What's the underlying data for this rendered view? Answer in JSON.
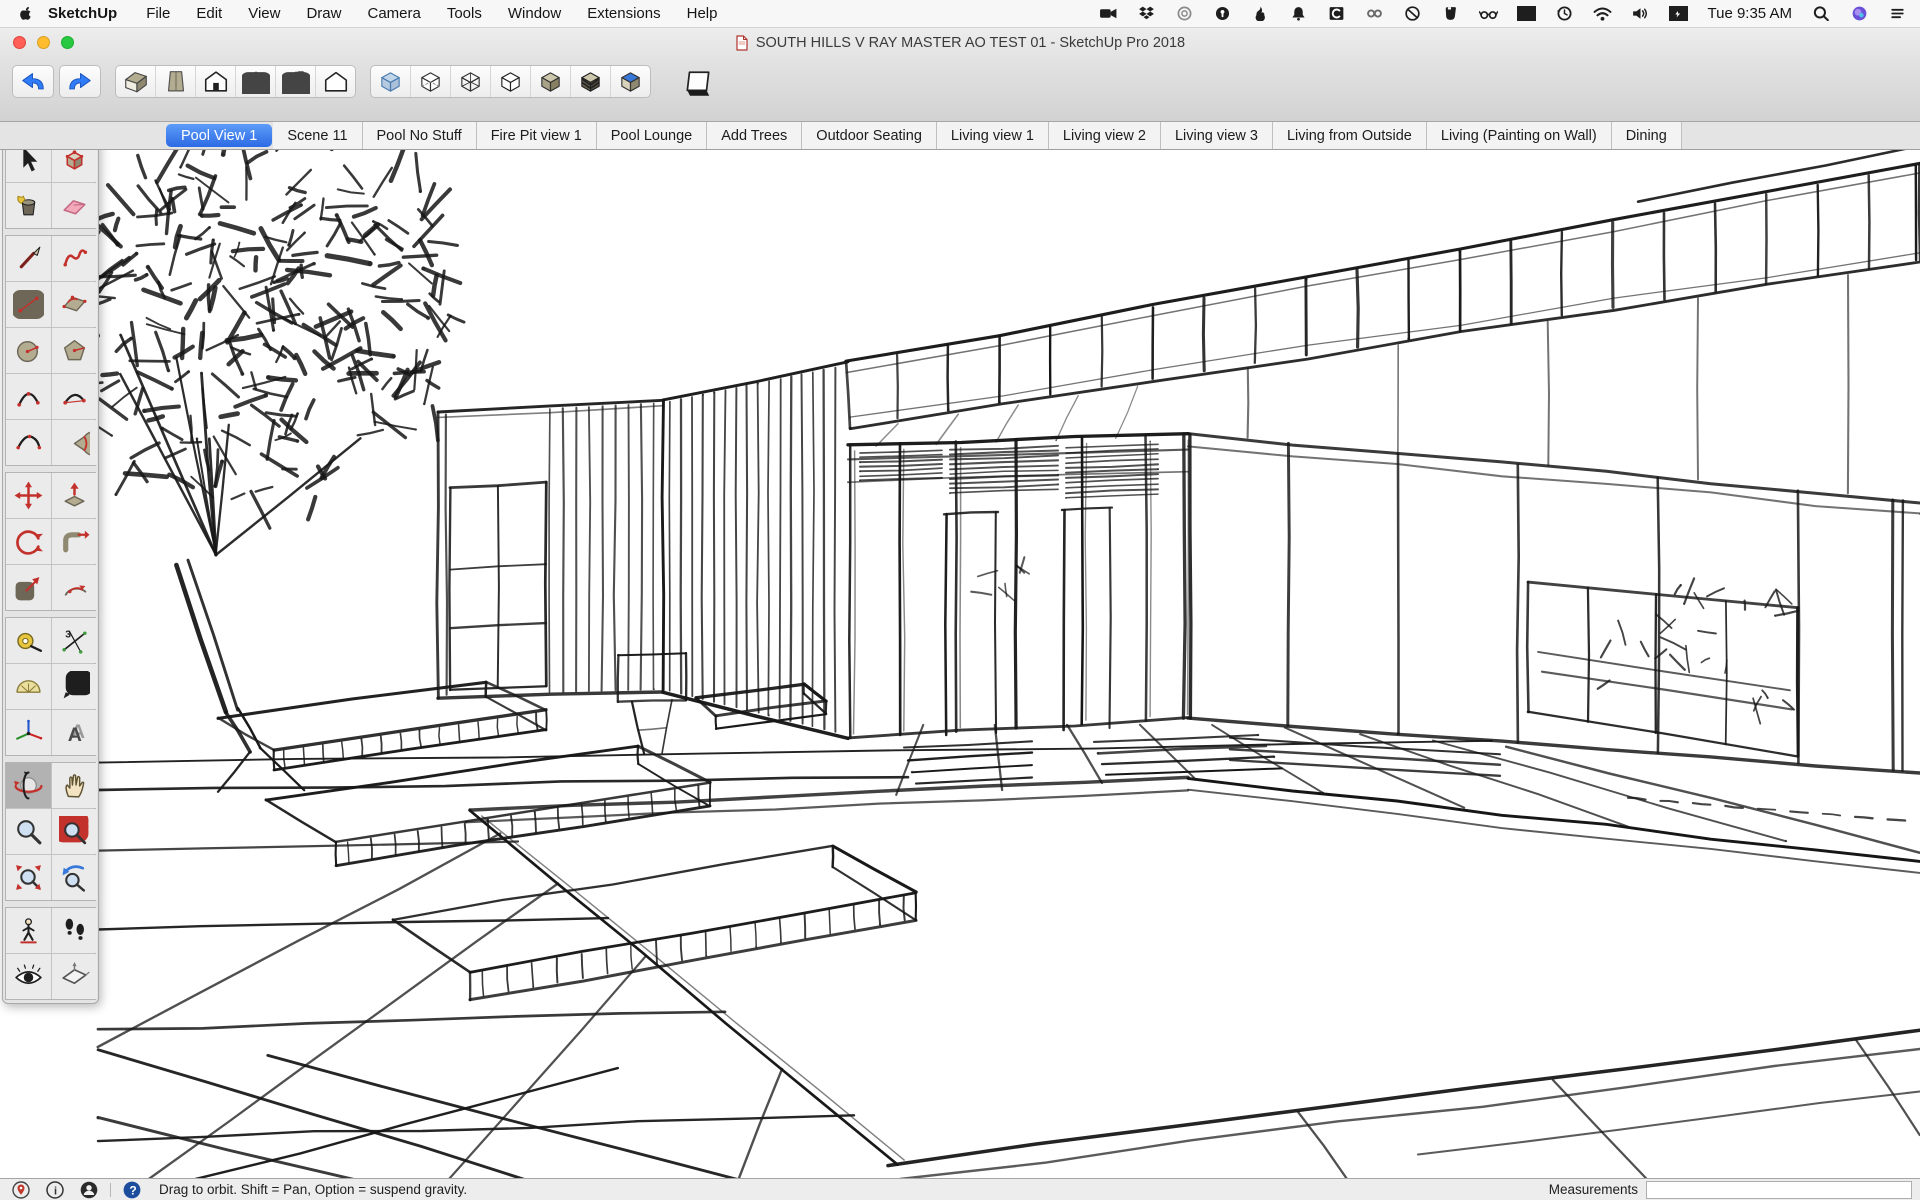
{
  "menu_bar": {
    "app_name": "SketchUp",
    "menus": [
      "File",
      "Edit",
      "View",
      "Draw",
      "Camera",
      "Tools",
      "Window",
      "Extensions",
      "Help"
    ],
    "status_icons": [
      "screen-mirroring",
      "dropbox",
      "adobe-creative-cloud",
      "one-password",
      "flame",
      "notifications",
      "contacts",
      "infinity",
      "do-not-disturb",
      "evernote",
      "glasses",
      "screenshot",
      "time-machine",
      "wifi",
      "volume",
      "battery"
    ],
    "clock": "Tue 9:35 AM",
    "right_icons": [
      "spotlight",
      "siri",
      "notification-center"
    ]
  },
  "window": {
    "title": "SOUTH HILLS V RAY MASTER AO TEST 01 - SketchUp Pro 2018"
  },
  "toolbar": {
    "undo": "undo",
    "redo": "redo",
    "views": [
      "iso",
      "top",
      "front",
      "right",
      "back",
      "left"
    ],
    "face_styles": [
      "x-ray",
      "back-edges",
      "wireframe",
      "hidden-line",
      "shaded",
      "shaded-with-textures",
      "monochrome"
    ],
    "extra": "section-display"
  },
  "scene_tabs": [
    {
      "label": "Pool View 1",
      "selected": true
    },
    {
      "label": "Scene 11"
    },
    {
      "label": "Pool No Stuff"
    },
    {
      "label": "Fire Pit view 1"
    },
    {
      "label": "Pool Lounge"
    },
    {
      "label": "Add Trees"
    },
    {
      "label": "Outdoor Seating"
    },
    {
      "label": "Living view 1"
    },
    {
      "label": "Living view 2"
    },
    {
      "label": "Living view 3"
    },
    {
      "label": "Living from Outside"
    },
    {
      "label": "Living (Painting on Wall)"
    },
    {
      "label": "Dining"
    }
  ],
  "tool_palette": {
    "active_tool": "orbit",
    "groups": [
      [
        "select",
        "make-component",
        "paint-bucket",
        "eraser"
      ],
      [
        "line",
        "freehand",
        "rectangle",
        "rotated-rectangle",
        "circle",
        "polygon",
        "arc",
        "two-point-arc",
        "three-point-arc",
        "pie"
      ],
      [
        "move",
        "push-pull",
        "rotate",
        "follow-me",
        "scale",
        "offset"
      ],
      [
        "tape-measure",
        "dimension",
        "protractor",
        "text",
        "axes",
        "3d-text"
      ],
      [
        "orbit",
        "pan",
        "zoom",
        "zoom-window",
        "zoom-extents",
        "previous"
      ],
      [
        "position-camera",
        "walk",
        "look-around",
        "section-plane"
      ]
    ]
  },
  "status_bar": {
    "icons": [
      "geolocation",
      "credits",
      "account",
      "help"
    ],
    "hint": "Drag to orbit. Shift = Pan, Option = suspend gravity.",
    "measurements_label": "Measurements",
    "measurements_value": ""
  },
  "accent_colors": {
    "selected_tab_blue": "#2c6ae4",
    "undo_arrow_blue": "#2f7cf6"
  }
}
